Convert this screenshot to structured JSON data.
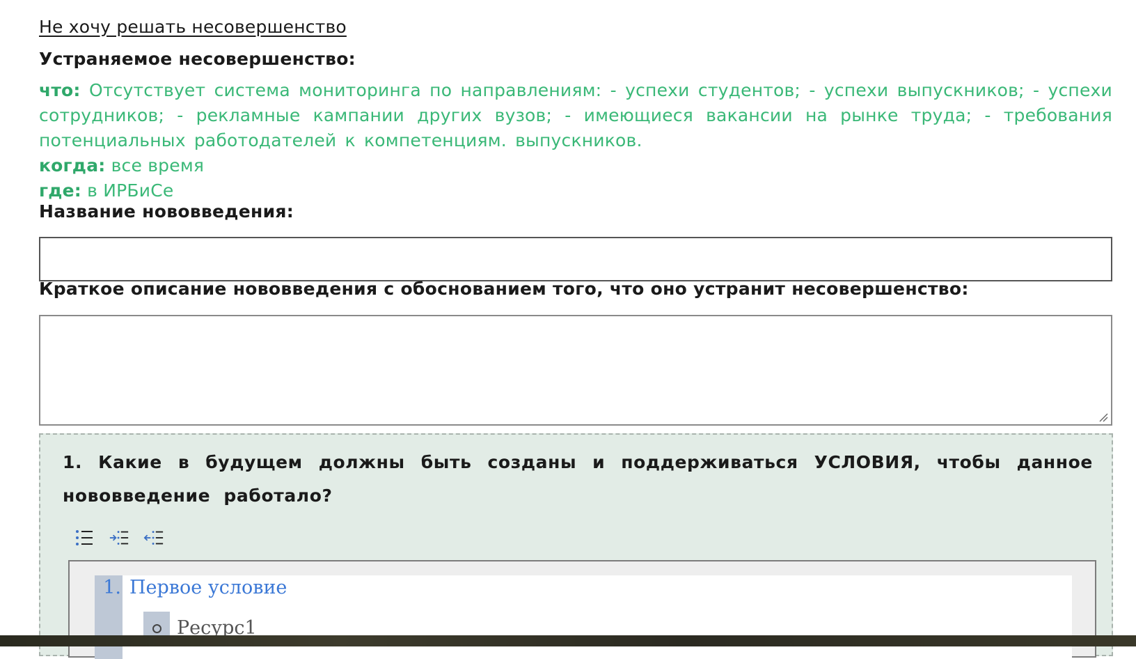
{
  "skip_link": "Не хочу решать несовершенство",
  "imperfection": {
    "heading": "Устраняемое несовершенство:",
    "what_label": "что:",
    "what_value": "Отсутствует система мониторинга по направлениям: - успехи студентов; - успехи выпускников; - успехи сотрудников; - рекламные кампании других вузов; - имеющиеся вакансии на рынке труда; - требования потенциальных работодателей к компетенциям. выпускников.",
    "when_label": "когда:",
    "when_value": "все время",
    "where_label": "где:",
    "where_value": "в ИРБиСе",
    "accent_color": "#3ab877"
  },
  "innovation_name": {
    "label": "Название нововведения:",
    "value": ""
  },
  "innovation_description": {
    "label": "Краткое описание нововведения с обоснованием того, что оно устранит несовершенство:",
    "value": ""
  },
  "conditions": {
    "question": "1. Какие в будущем должны быть созданы и поддерживаться УСЛОВИЯ, чтобы данное нововведение работало?",
    "toolbar": {
      "list_icon": "bulleted-list-icon",
      "indent_icon": "indent-icon",
      "outdent_icon": "outdent-icon"
    },
    "items": [
      {
        "number": "1.",
        "text": "Первое условие",
        "sub_items": [
          "Ресурс1"
        ]
      }
    ],
    "box_color": "#e2ece6"
  }
}
